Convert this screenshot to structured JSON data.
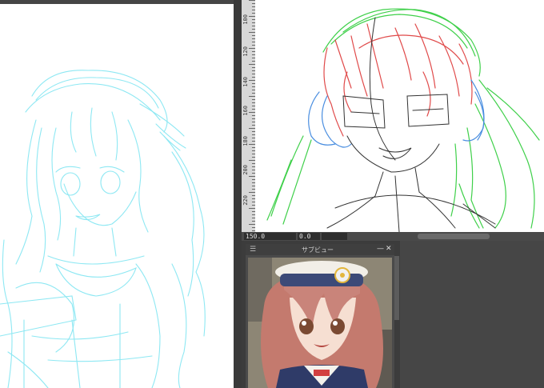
{
  "subview": {
    "title": "サブビュー",
    "menu_icon": "menu-icon",
    "minimize_icon": "minimize-icon",
    "close_icon": "close-icon",
    "minimize_glyph": "—",
    "close_glyph": "✕",
    "menu_glyph": "☰"
  },
  "ruler": {
    "labels": [
      "100",
      "120",
      "140",
      "160",
      "180",
      "200",
      "220"
    ]
  },
  "statusbar": {
    "zoom_value": "150.0",
    "rotation_value": "0.0"
  },
  "colors": {
    "sketch_cyan": "#7fe6f2",
    "sketch_red": "#e04a4a",
    "sketch_blue": "#4a8ee0",
    "sketch_green": "#3fd04a",
    "sketch_black": "#333333",
    "panel_dark": "#3c3c3c"
  }
}
